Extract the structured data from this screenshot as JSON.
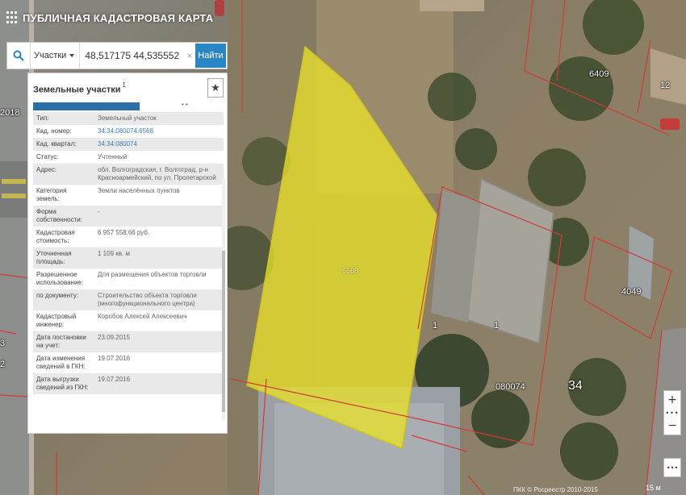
{
  "app": {
    "title": "ПУБЛИЧНАЯ КАДАСТРОВАЯ КАРТА"
  },
  "search": {
    "type_select": "Участки",
    "query": "48,517175 44,535552",
    "find_label": "Найти",
    "clear_glyph": "×"
  },
  "panel": {
    "title": "Земельные участки",
    "count": "1",
    "star_glyph": "★",
    "rows": [
      {
        "key": "Тип:",
        "value": "Земельный участок"
      },
      {
        "key": "Кад. номер:",
        "value": "34:34:080074:6568",
        "link": true
      },
      {
        "key": "Кад. квартал:",
        "value": "34:34:080074",
        "link": true
      },
      {
        "key": "Статус:",
        "value": "Учтенный"
      },
      {
        "key": "Адрес:",
        "value": "обл. Волгоградская, г. Волгоград, р-н Красноармейский, по ул. Пролетарской"
      },
      {
        "key": "Категория земель:",
        "value": "Земли населённых пунктов"
      },
      {
        "key": "Форма собственности:",
        "value": "-"
      },
      {
        "key": "Кадастровая стоимость:",
        "value": "6 957 558,66 руб."
      },
      {
        "key": "Уточненная площадь:",
        "value": "1 109 кв. м"
      },
      {
        "key": "Разрешенное использование:",
        "value": "Для размещения объектов торговли"
      },
      {
        "key": "по документу:",
        "value": "Строительство объекта торговли (многофункционального центра)"
      },
      {
        "key": "Кадастровый инженер:",
        "value": "Коробов Алексей Алексеевич"
      },
      {
        "key": "Дата постановки на учет:",
        "value": "23.09.2015"
      },
      {
        "key": "Дата изменения сведений в ГКН:",
        "value": "19.07.2016"
      },
      {
        "key": "Дата выгрузки сведений из ГКН:",
        "value": "19.07.2016"
      }
    ]
  },
  "map": {
    "labels": {
      "selected_parcel": "6568",
      "parcel_a": "1",
      "parcel_b": "1",
      "quarter": "080074",
      "block": "34",
      "parcel_c": "6409",
      "parcel_d": "12",
      "parcel_e": "4049",
      "left_edge_1": "2018",
      "left_edge_2": "3",
      "left_edge_3": "2"
    },
    "attribution": "ПКК © Росреестр 2010-2015",
    "scale": "15 м",
    "colors": {
      "selected_fill": "#e8e22a",
      "parcel_border": "#d23a3a",
      "accent": "#2a86c2"
    }
  },
  "controls": {
    "zoom_in": "+",
    "dots": "•••",
    "zoom_out": "−",
    "more": "•••"
  }
}
